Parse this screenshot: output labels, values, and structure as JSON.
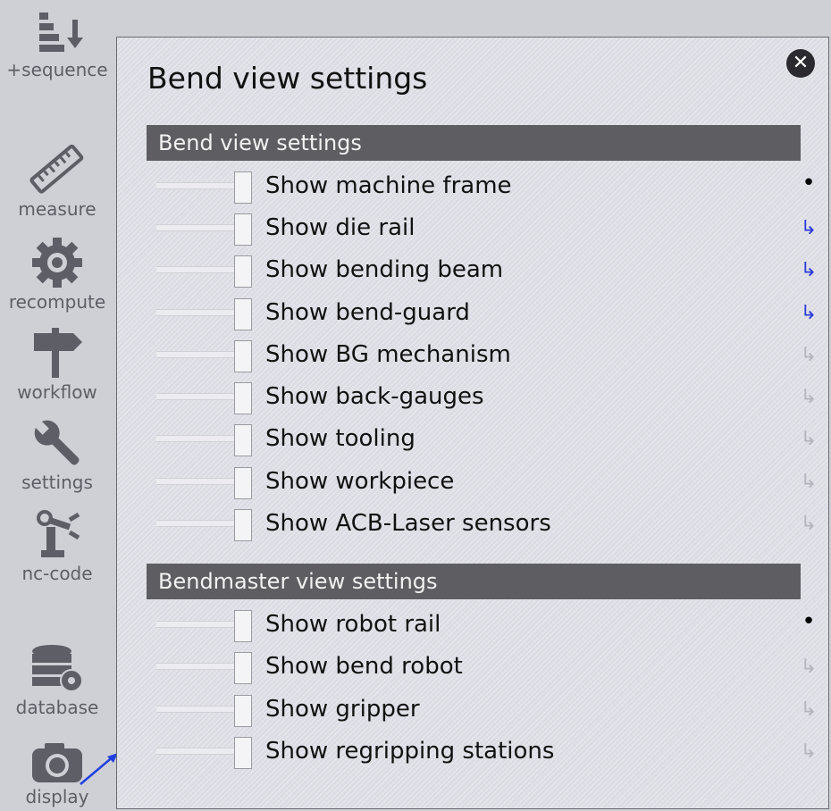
{
  "sidebar": {
    "items": [
      {
        "label": "+sequence",
        "icon": "sequence-icon"
      },
      {
        "label": "measure",
        "icon": "ruler-icon"
      },
      {
        "label": "recompute",
        "icon": "gear-icon"
      },
      {
        "label": "workflow",
        "icon": "signpost-icon"
      },
      {
        "label": "settings",
        "icon": "wrench-icon"
      },
      {
        "label": "nc-code",
        "icon": "robot-arm-icon"
      },
      {
        "label": "database",
        "icon": "database-gear-icon"
      },
      {
        "label": "display",
        "icon": "camera-icon"
      }
    ]
  },
  "panel": {
    "title": "Bend view settings",
    "close_glyph": "✕",
    "sections": [
      {
        "header": "Bend view settings",
        "rows": [
          {
            "label": "Show machine frame",
            "indicator": "•",
            "indicator_type": "dot"
          },
          {
            "label": "Show die rail",
            "indicator": "↳",
            "indicator_type": "blue"
          },
          {
            "label": "Show bending beam",
            "indicator": "↳",
            "indicator_type": "blue"
          },
          {
            "label": "Show bend-guard",
            "indicator": "↳",
            "indicator_type": "blue"
          },
          {
            "label": "Show BG mechanism",
            "indicator": "↳",
            "indicator_type": "gray"
          },
          {
            "label": "Show back-gauges",
            "indicator": "↳",
            "indicator_type": "gray"
          },
          {
            "label": "Show tooling",
            "indicator": "↳",
            "indicator_type": "gray"
          },
          {
            "label": "Show workpiece",
            "indicator": "↳",
            "indicator_type": "gray"
          },
          {
            "label": "Show ACB-Laser sensors",
            "indicator": "↳",
            "indicator_type": "gray"
          }
        ]
      },
      {
        "header": "Bendmaster view settings",
        "rows": [
          {
            "label": "Show robot rail",
            "indicator": "•",
            "indicator_type": "dot"
          },
          {
            "label": "Show bend robot",
            "indicator": "↳",
            "indicator_type": "gray"
          },
          {
            "label": "Show gripper",
            "indicator": "↳",
            "indicator_type": "gray"
          },
          {
            "label": "Show regripping stations",
            "indicator": "↳",
            "indicator_type": "gray"
          }
        ]
      }
    ]
  },
  "colors": {
    "section_header_bg": "#5d5d62",
    "indicator_blue": "#2b3bd9",
    "indicator_gray": "#b4b4bc",
    "annotation_arrow": "#2040e0"
  }
}
